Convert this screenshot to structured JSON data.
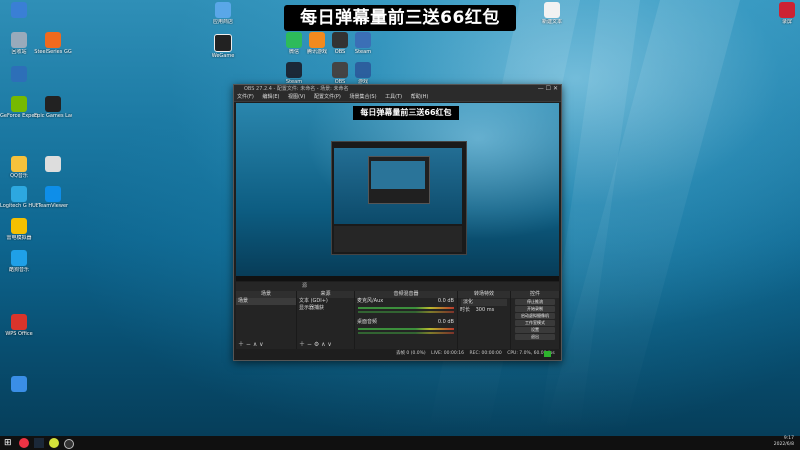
{
  "banner": {
    "text": "每日弹幕量前三送66红包"
  },
  "desktop_icons": [
    {
      "label": "",
      "color": "#3a7fd5"
    },
    {
      "label": "回收站",
      "color": "#9ab"
    },
    {
      "label": "",
      "color": "#2d6fb8"
    },
    {
      "label": "GeForce Experience",
      "color": "#76b900"
    },
    {
      "label": "QQ音乐",
      "color": "#f6c23c"
    },
    {
      "label": "Logitech G HUB",
      "color": "#2da8e0"
    },
    {
      "label": "雷电模拟器",
      "color": "#f5c000"
    },
    {
      "label": "酷狗音乐",
      "color": "#1fa0e8"
    },
    {
      "label": "WPS Office",
      "color": "#d9342b"
    },
    {
      "label": "",
      "color": "#3a8ee6"
    },
    {
      "label": "SteelSeries GG",
      "color": "#f06a1e"
    },
    {
      "label": "Epic Games Launcher",
      "color": "#222"
    },
    {
      "label": "TeamViewer",
      "color": "#0e8ee9"
    },
    {
      "label": "",
      "color": "#ddd"
    }
  ],
  "obs": {
    "title": "OBS 27.2.4 - 配置文件: 未命名 - 场景: 未命名",
    "menu": [
      "文件(F)",
      "编辑(E)",
      "视图(V)",
      "配置文件(P)",
      "场景集合(S)",
      "工具(T)",
      "帮助(H)"
    ],
    "preview_banner": "每日弹幕量前三送66红包",
    "toolbar_label": "源",
    "docks": {
      "scenes": {
        "header": "场景",
        "items": [
          "场景"
        ]
      },
      "sources": {
        "header": "来源",
        "items": [
          "文本 (GDI+)",
          "显示器捕获"
        ]
      },
      "mixer": {
        "header": "音频混音器",
        "channels": [
          {
            "name": "麦克风/Aux",
            "level": "0.0 dB"
          },
          {
            "name": "桌面音频",
            "level": "0.0 dB"
          }
        ]
      },
      "transitions": {
        "header": "转场特效",
        "type": "淡化",
        "duration_label": "时长",
        "duration": "300 ms"
      },
      "controls": {
        "header": "控件",
        "buttons": [
          "停止推流",
          "开始录制",
          "启动虚拟摄像机",
          "工作室模式",
          "设置",
          "退出"
        ]
      }
    },
    "status": {
      "dropped": "丢帧 0 (0.0%)",
      "live": "LIVE: 00:00:16",
      "rec": "REC: 00:00:00",
      "cpu": "CPU: 7.0%, 60.00 fps",
      "bitrate": "kb/s: 2566"
    }
  },
  "taskbar": {
    "time": "9:17",
    "date": "2022/6/8"
  }
}
